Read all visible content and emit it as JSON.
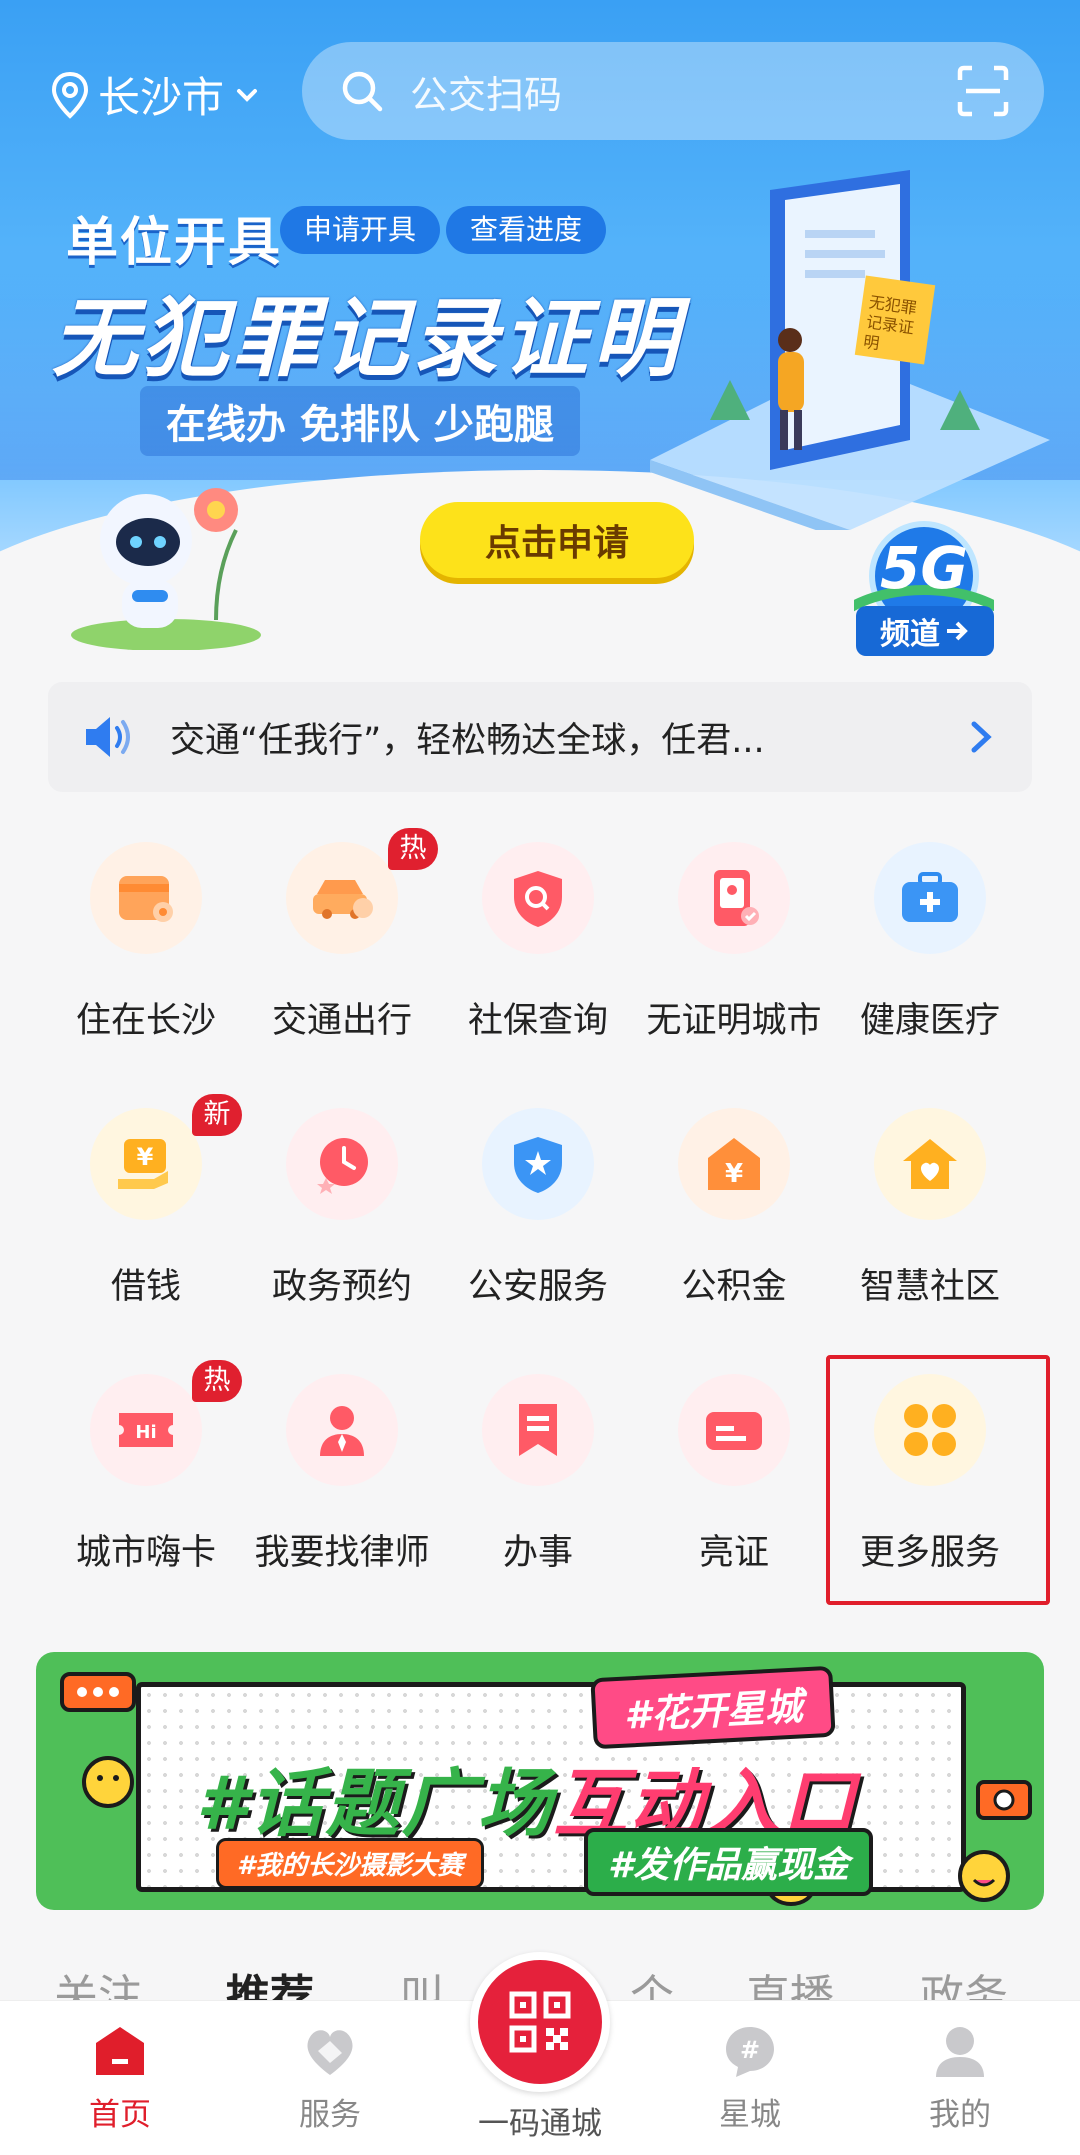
{
  "header": {
    "city": "长沙市",
    "search_placeholder": "公交扫码"
  },
  "hero": {
    "subtitle": "单位开具",
    "pill_apply": "申请开具",
    "pill_progress": "查看进度",
    "title": "无犯罪记录证明",
    "slogan": "在线办 免排队 少跑腿",
    "cta": "点击申请",
    "doc_tag": "无犯罪记录证明",
    "badge_5g": "5G",
    "channel": "频道"
  },
  "notice": {
    "text": "交通“任我行”，轻松畅达全球，任君..."
  },
  "services": [
    {
      "label": "住在长沙",
      "icon": "wallet-pin-icon",
      "tag": ""
    },
    {
      "label": "交通出行",
      "icon": "car-icon",
      "tag": "热"
    },
    {
      "label": "社保查询",
      "icon": "shield-search-icon",
      "tag": ""
    },
    {
      "label": "无证明城市",
      "icon": "phone-id-icon",
      "tag": ""
    },
    {
      "label": "健康医疗",
      "icon": "medical-kit-icon",
      "tag": ""
    },
    {
      "label": "借钱",
      "icon": "yuan-hand-icon",
      "tag": "新"
    },
    {
      "label": "政务预约",
      "icon": "clock-icon",
      "tag": ""
    },
    {
      "label": "公安服务",
      "icon": "police-badge-icon",
      "tag": ""
    },
    {
      "label": "公积金",
      "icon": "yuan-house-icon",
      "tag": ""
    },
    {
      "label": "智慧社区",
      "icon": "home-heart-icon",
      "tag": ""
    },
    {
      "label": "城市嗨卡",
      "icon": "hi-ticket-icon",
      "tag": "热"
    },
    {
      "label": "我要找律师",
      "icon": "lawyer-icon",
      "tag": ""
    },
    {
      "label": "办事",
      "icon": "bookmark-icon",
      "tag": ""
    },
    {
      "label": "亮证",
      "icon": "card-icon",
      "tag": ""
    },
    {
      "label": "更多服务",
      "icon": "clover-icon",
      "tag": ""
    }
  ],
  "topic_banner": {
    "tag": "#花开星城",
    "title_part1": "#话题广场",
    "title_part2": "互动入口",
    "sub1": "#我的长沙摄影大赛",
    "sub2": "#发作品赢现金"
  },
  "feed_tabs": [
    "关注",
    "推荐",
    "叫",
    "个",
    "直播",
    "政务"
  ],
  "nav": {
    "home": "首页",
    "services": "服务",
    "qr": "一码通城",
    "star_city": "星城",
    "mine": "我的"
  },
  "colors": {
    "brand_red": "#e01e2b",
    "hero_blue": "#3aa0f4",
    "cta_yellow": "#fde21a"
  }
}
